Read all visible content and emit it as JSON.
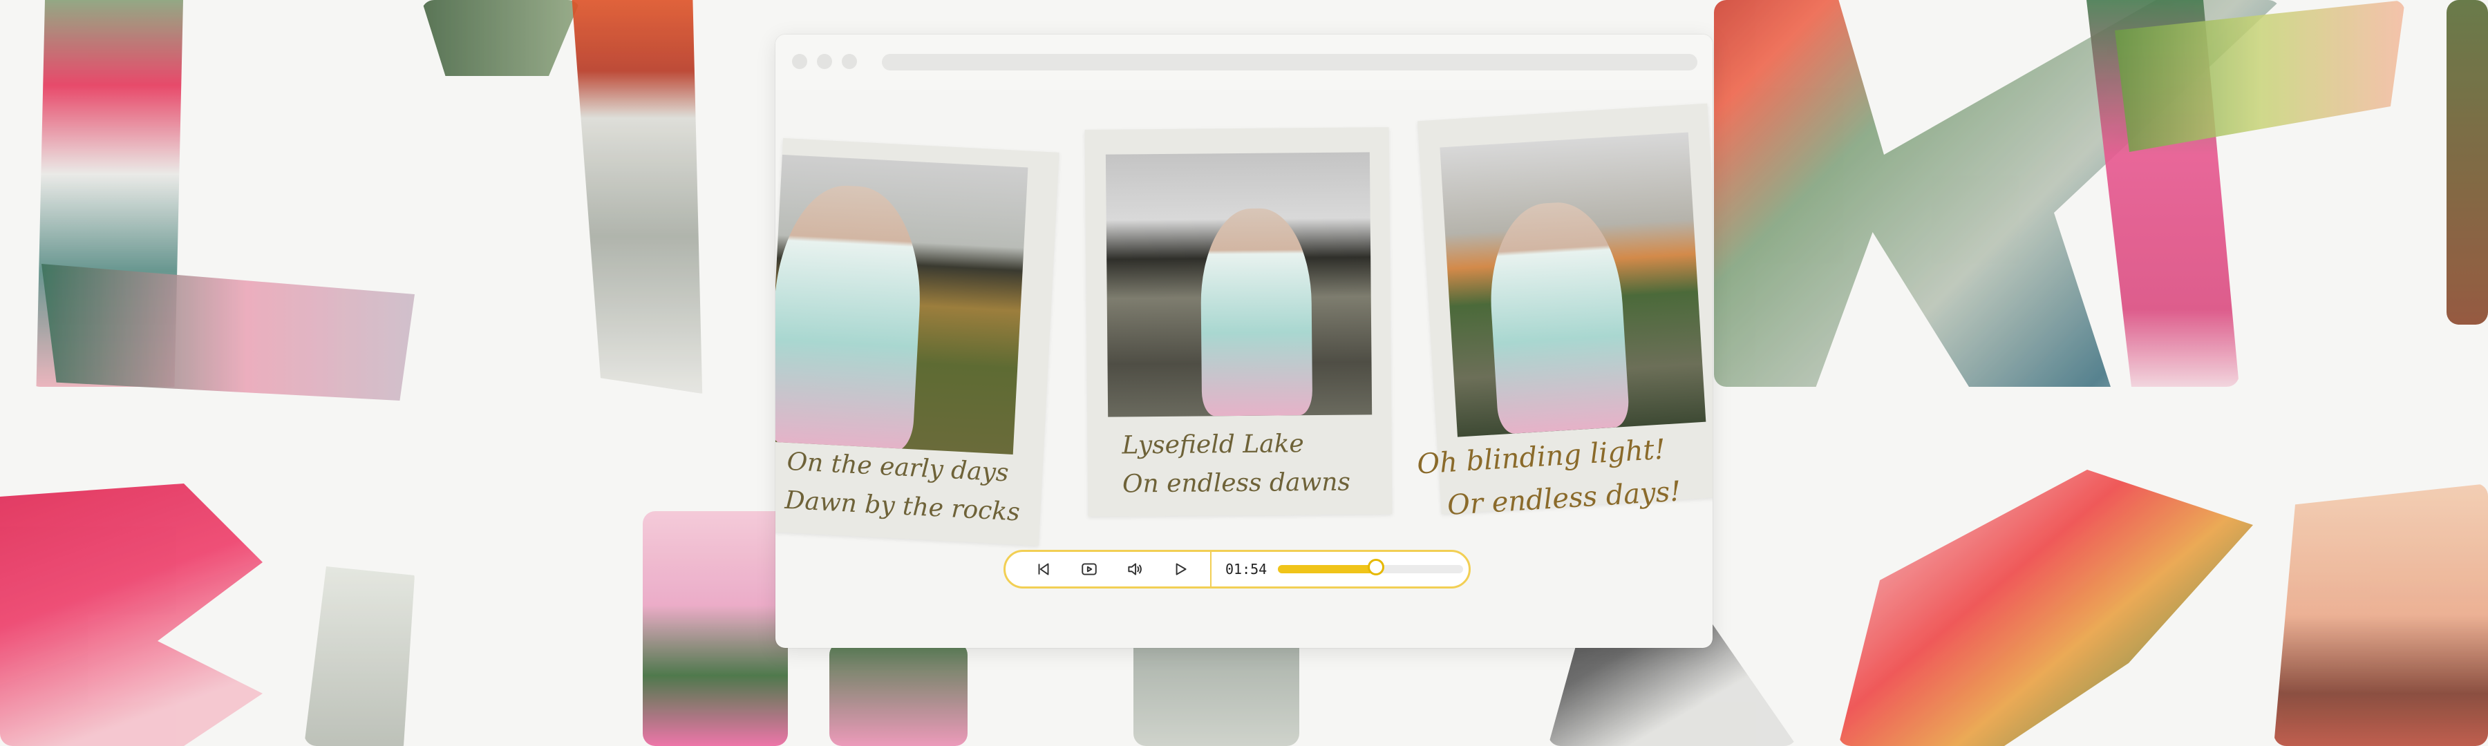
{
  "polaroids": [
    {
      "caption_line1": "On the early days",
      "caption_line2": "Dawn by the rocks"
    },
    {
      "caption_line1": "Lysefield Lake",
      "caption_line2": "On endless dawns"
    },
    {
      "caption_line1": "Oh blinding light!",
      "caption_line2": "Or endless days!"
    }
  ],
  "player": {
    "time": "01:54",
    "progress": 0.53,
    "controls": [
      "skip-back-icon",
      "video-icon",
      "volume-icon",
      "play-icon"
    ]
  },
  "colors": {
    "accent": "#f2cf54",
    "progress_fill": "#f0c419",
    "background": "#f6f6f4",
    "window": "#f5f5f3"
  }
}
